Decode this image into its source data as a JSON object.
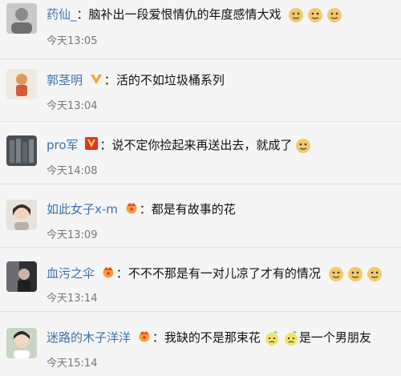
{
  "comments": [
    {
      "username": "药仙_",
      "colon": "：",
      "text": "脑补出一段爱恨情仇的年度感情大戏",
      "time": "今天13:05",
      "emojis": [
        "doge-icon",
        "doge-icon",
        "doge-icon"
      ]
    },
    {
      "username": "郭茎明",
      "colon": "：",
      "text": "活的不如垃圾桶系列",
      "time": "今天13:04",
      "badge": "yellow-v-badge"
    },
    {
      "username": "pro军",
      "colon": "：",
      "text": "说不定你捡起来再送出去，就成了",
      "time": "今天14:08",
      "badge": "red-v-badge",
      "emojis": [
        "doge-icon"
      ]
    },
    {
      "username": "如此女子x-m",
      "colon": "：",
      "text": "都是有故事的花",
      "time": "今天13:09",
      "badge": "crown-badge"
    },
    {
      "username": "血污之伞",
      "colon": "：",
      "text": "不不不那是有一对儿凉了才有的情况",
      "time": "今天13:14",
      "badge": "crown-badge",
      "emojis": [
        "doge-icon",
        "doge-icon",
        "doge-icon"
      ]
    },
    {
      "username": "迷路的木子洋洋",
      "colon": "：",
      "text": "我缺的不是那束花",
      "text2": "是一个男朋友",
      "time": "今天15:14",
      "badge": "crown-badge",
      "emojis": [
        "lemon-face-icon",
        "lemon-face-icon"
      ]
    }
  ]
}
